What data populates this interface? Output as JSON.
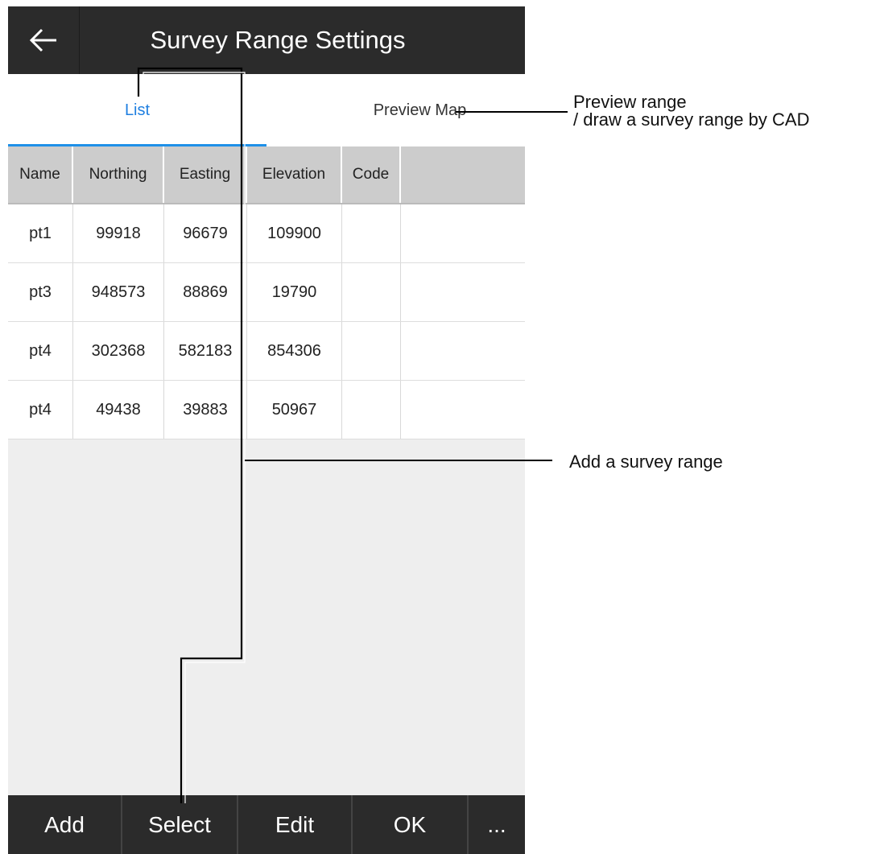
{
  "header": {
    "title": "Survey Range Settings",
    "back_icon": "arrow-left-icon"
  },
  "tabs": [
    {
      "label": "List",
      "active": true
    },
    {
      "label": "Preview Map",
      "active": false
    }
  ],
  "table": {
    "columns": [
      "Name",
      "Northing",
      "Easting",
      "Elevation",
      "Code",
      ""
    ],
    "rows": [
      [
        "pt1",
        "99918",
        "96679",
        "109900",
        "",
        ""
      ],
      [
        "pt3",
        "948573",
        "88869",
        "19790",
        "",
        ""
      ],
      [
        "pt4",
        "302368",
        "582183",
        "854306",
        "",
        ""
      ],
      [
        "pt4",
        "49438",
        "39883",
        "50967",
        "",
        ""
      ]
    ]
  },
  "toolbar": {
    "add_label": "Add",
    "select_label": "Select",
    "edit_label": "Edit",
    "ok_label": "OK",
    "more_label": "..."
  },
  "callouts": {
    "preview_map_line1": "Preview range",
    "preview_map_line2": "/ draw a survey range by CAD",
    "add_range": "Add a survey range"
  },
  "colors": {
    "accent": "#1e90e8",
    "bar": "#2b2b2b",
    "header_row": "#cccccc"
  }
}
